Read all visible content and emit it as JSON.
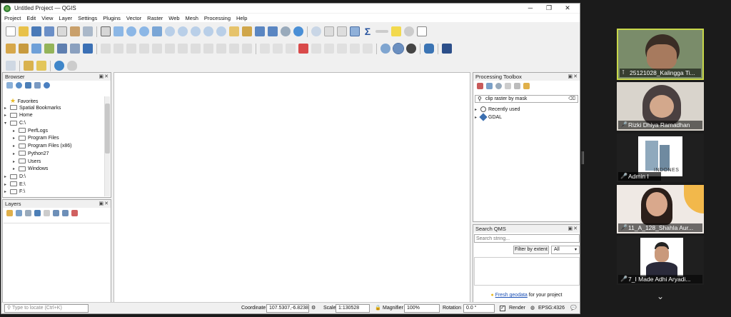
{
  "window": {
    "title": "Untitled Project — QGIS",
    "min": "─",
    "max": "❐",
    "close": "✕"
  },
  "menu": [
    "Project",
    "Edit",
    "View",
    "Layer",
    "Settings",
    "Plugins",
    "Vector",
    "Raster",
    "Web",
    "Mesh",
    "Processing",
    "Help"
  ],
  "browser": {
    "title": "Browser",
    "items": [
      {
        "label": "Favorites",
        "arrow": "",
        "icon": "star"
      },
      {
        "label": "Spatial Bookmarks",
        "arrow": "▸",
        "icon": "folder"
      },
      {
        "label": "Home",
        "arrow": "▸",
        "icon": "folder"
      },
      {
        "label": "C:\\",
        "arrow": "▾",
        "icon": "drive"
      },
      {
        "label": "PerfLogs",
        "arrow": "▸",
        "icon": "folder",
        "indent": 1
      },
      {
        "label": "Program Files",
        "arrow": "▸",
        "icon": "folder",
        "indent": 1
      },
      {
        "label": "Program Files (x86)",
        "arrow": "▸",
        "icon": "folder",
        "indent": 1
      },
      {
        "label": "Python27",
        "arrow": "▸",
        "icon": "folder",
        "indent": 1
      },
      {
        "label": "Users",
        "arrow": "▸",
        "icon": "folder",
        "indent": 1
      },
      {
        "label": "Windows",
        "arrow": "▸",
        "icon": "folder",
        "indent": 1
      },
      {
        "label": "D:\\",
        "arrow": "▸",
        "icon": "drive"
      },
      {
        "label": "E:\\",
        "arrow": "▸",
        "icon": "drive"
      },
      {
        "label": "F:\\",
        "arrow": "▸",
        "icon": "drive"
      }
    ]
  },
  "layers": {
    "title": "Layers"
  },
  "processing": {
    "title": "Processing Toolbox",
    "search_value": "clip raster by mask",
    "items": [
      {
        "label": "Recently used",
        "icon": "clock"
      },
      {
        "label": "GDAL",
        "icon": "gdal"
      }
    ]
  },
  "qms": {
    "title": "Search QMS",
    "placeholder": "Search string...",
    "filter_label": "Filter by extent",
    "select_value": "All",
    "footer_link": "Fresh geodata",
    "footer_text": " for your project"
  },
  "status": {
    "locator_placeholder": "Type to locate (Ctrl+K)",
    "coordinate_label": "Coordinate",
    "coordinate_value": "107.5307,-6.8238",
    "scale_label": "Scale",
    "scale_value": "1:130528",
    "magnifier_label": "Magnifier",
    "magnifier_value": "100%",
    "rotation_label": "Rotation",
    "rotation_value": "0.0 °",
    "render_label": "Render",
    "crs": "EPSG:4326"
  },
  "participants": [
    {
      "name": "25121028_Kalingga Ti...",
      "active": true,
      "muted": false
    },
    {
      "name": "Rizki Dhiya Ramadhan",
      "active": false,
      "muted": true
    },
    {
      "name": "Admin I",
      "active": false,
      "muted": true
    },
    {
      "name": "11_A_128_Shahla Aur...",
      "active": false,
      "muted": true
    },
    {
      "name": "7_I Made Adhi Aryadi...",
      "active": false,
      "muted": true
    }
  ],
  "admin_logo_text": "INDONES",
  "colors": {
    "active_border": "#c8d84a",
    "muted_icon": "#e33333",
    "link": "#1a4fb5"
  }
}
